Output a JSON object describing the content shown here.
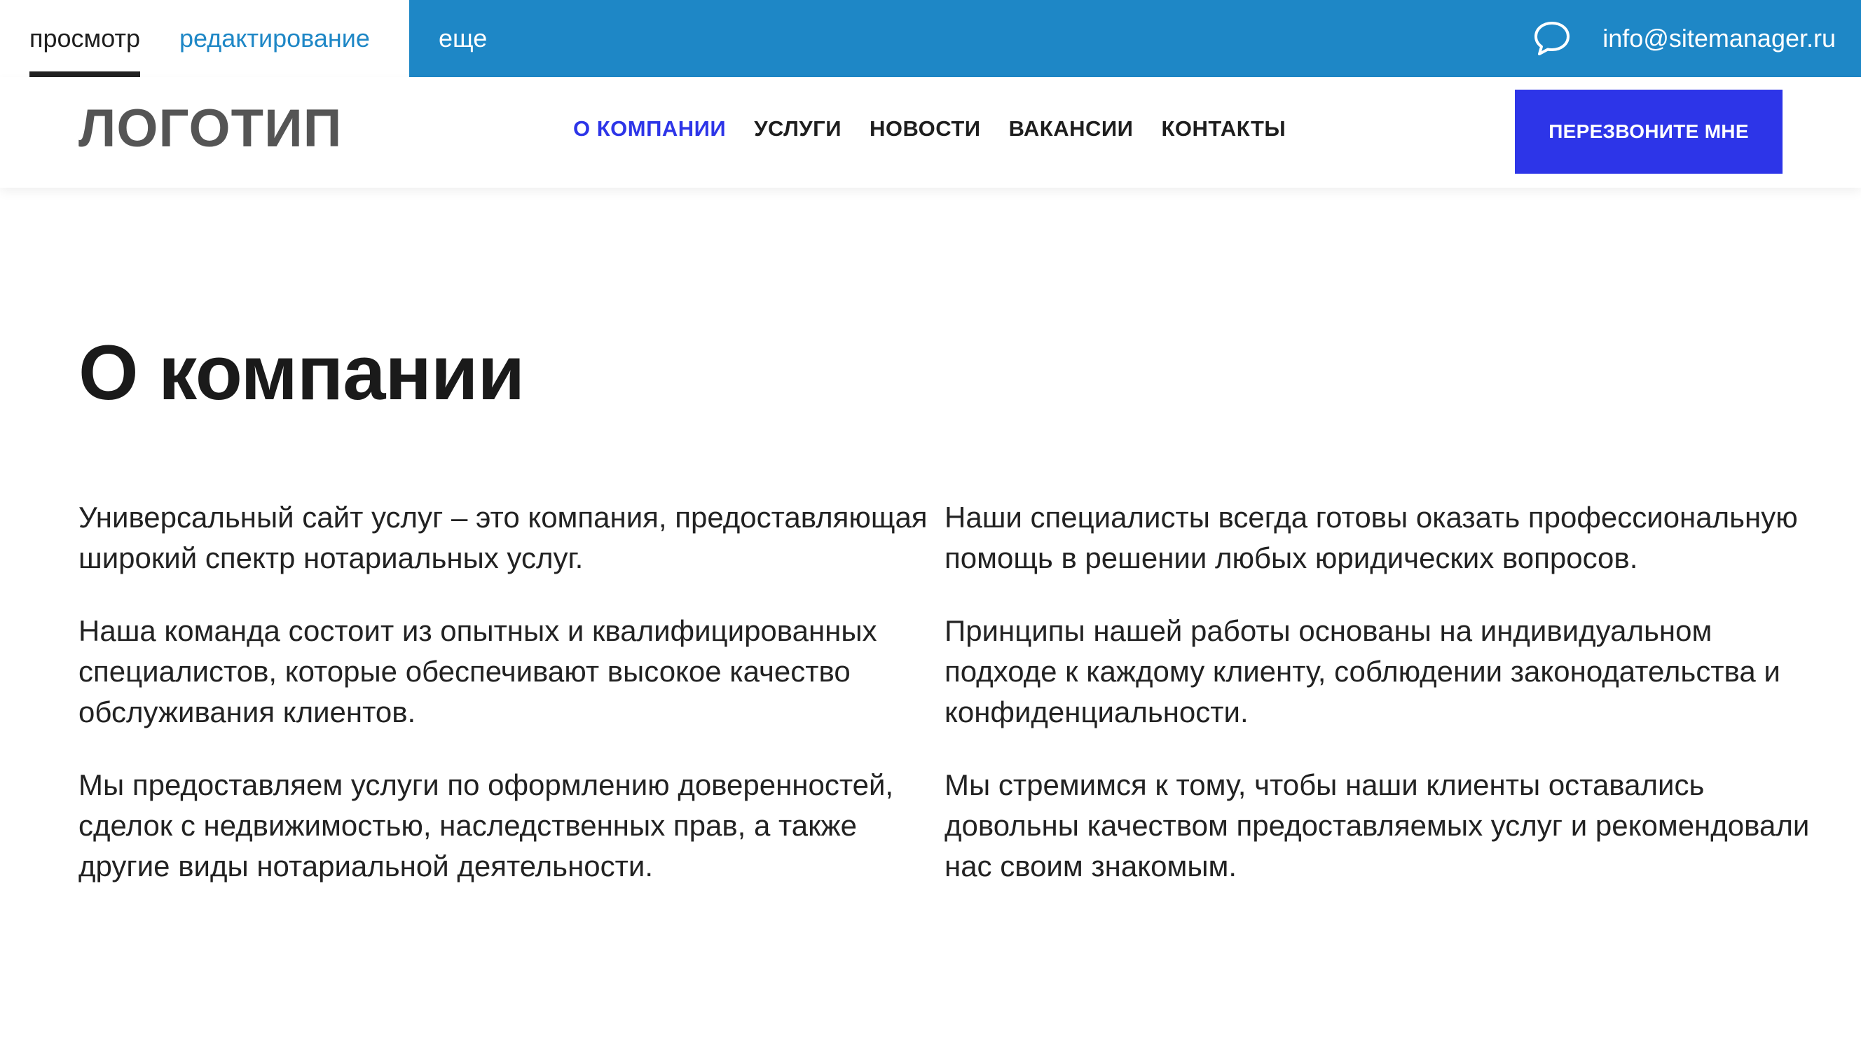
{
  "admin_bar": {
    "tabs": [
      {
        "label": "просмотр",
        "active": true
      },
      {
        "label": "редактирование",
        "active": false
      }
    ],
    "more_label": "еще",
    "chat_icon": "speech-bubble-icon",
    "email": "info@sitemanager.ru",
    "accent_color": "#1e87c6"
  },
  "header": {
    "logo": "ЛОГОТИП",
    "nav": [
      {
        "label": "О КОМПАНИИ",
        "active": true
      },
      {
        "label": "УСЛУГИ",
        "active": false
      },
      {
        "label": "НОВОСТИ",
        "active": false
      },
      {
        "label": "ВАКАНСИИ",
        "active": false
      },
      {
        "label": "КОНТАКТЫ",
        "active": false
      }
    ],
    "callback_label": "ПЕРЕЗВОНИТЕ МНЕ",
    "brand_color": "#2d35e8"
  },
  "main": {
    "title": "О компании",
    "left_paragraphs": [
      "Универсальный сайт услуг – это компания, предоставляющая широкий спектр нотариальных услуг.",
      "Наша команда состоит из опытных и квалифицированных специалистов, которые обеспечивают высокое качество обслуживания клиентов.",
      "Мы предоставляем услуги по оформлению доверенностей, сделок с недвижимостью, наследственных прав, а также другие виды нотариальной деятельности."
    ],
    "right_paragraphs": [
      "Наши специалисты всегда готовы оказать профессиональную помощь в решении любых юридических вопросов.",
      "Принципы нашей работы основаны на индивидуальном подходе к каждому клиенту, соблюдении законодательства и конфиденциальности.",
      "Мы стремимся к тому, чтобы наши клиенты оставались довольны качеством предоставляемых услуг и рекомендовали нас своим знакомым."
    ]
  }
}
